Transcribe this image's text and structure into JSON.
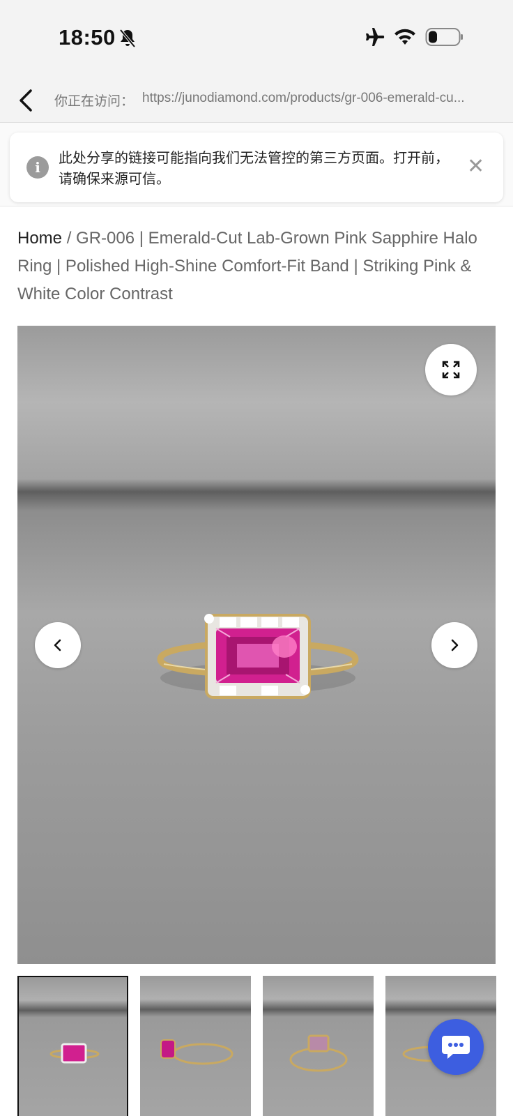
{
  "status_bar": {
    "time": "18:50"
  },
  "browser": {
    "visiting_label": "你正在访问：",
    "url": "https://junodiamond.com/products/gr-006-emerald-cu..."
  },
  "warning": {
    "text": "此处分享的链接可能指向我们无法管控的第三方页面。打开前，请确保来源可信。"
  },
  "breadcrumb": {
    "home": "Home",
    "separator": "/",
    "current": "GR-006 | Emerald-Cut Lab-Grown Pink Sapphire Halo Ring | Polished High-Shine Comfort-Fit Band | Striking Pink & White Color Contrast"
  },
  "colors": {
    "chat_button": "#3d5ee0",
    "sapphire": "#d1208f",
    "gold": "#c9a961"
  }
}
